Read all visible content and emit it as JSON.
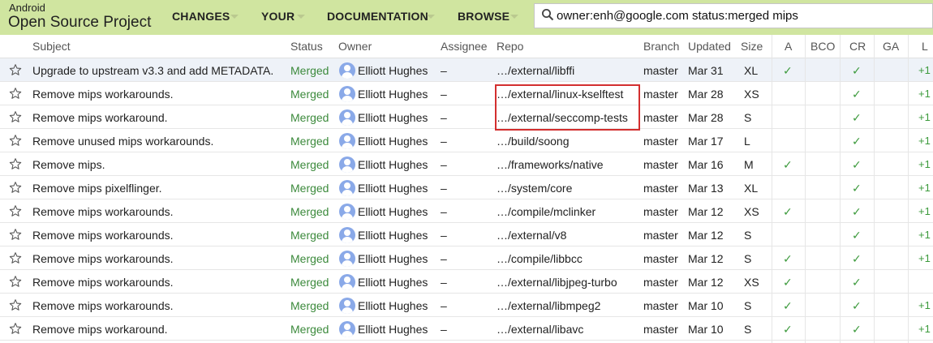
{
  "brand": {
    "top": "Android",
    "main": "Open Source Project"
  },
  "nav": [
    "CHANGES",
    "YOUR",
    "DOCUMENTATION",
    "BROWSE"
  ],
  "search": {
    "value": "owner:enh@google.com status:merged mips"
  },
  "columns": [
    "Subject",
    "Status",
    "Owner",
    "Assignee",
    "Repo",
    "Branch",
    "Updated",
    "Size",
    "A",
    "BCO",
    "CR",
    "GA",
    "L"
  ],
  "rows": [
    {
      "subject": "Upgrade to upstream v3.3 and add METADATA.",
      "status": "Merged",
      "owner": "Elliott Hughes",
      "assignee": "–",
      "repo": "…/external/libffi",
      "branch": "master",
      "updated": "Mar 31",
      "size": "XL",
      "a": "✓",
      "bco": "",
      "cr": "✓",
      "ga": "",
      "l": "+1"
    },
    {
      "subject": "Remove mips workarounds.",
      "status": "Merged",
      "owner": "Elliott Hughes",
      "assignee": "–",
      "repo": "…/external/linux-kselftest",
      "branch": "master",
      "updated": "Mar 28",
      "size": "XS",
      "a": "",
      "bco": "",
      "cr": "✓",
      "ga": "",
      "l": "+1"
    },
    {
      "subject": "Remove mips workaround.",
      "status": "Merged",
      "owner": "Elliott Hughes",
      "assignee": "–",
      "repo": "…/external/seccomp-tests",
      "branch": "master",
      "updated": "Mar 28",
      "size": "S",
      "a": "",
      "bco": "",
      "cr": "✓",
      "ga": "",
      "l": "+1"
    },
    {
      "subject": "Remove unused mips workarounds.",
      "status": "Merged",
      "owner": "Elliott Hughes",
      "assignee": "–",
      "repo": "…/build/soong",
      "branch": "master",
      "updated": "Mar 17",
      "size": "L",
      "a": "",
      "bco": "",
      "cr": "✓",
      "ga": "",
      "l": "+1"
    },
    {
      "subject": "Remove mips.",
      "status": "Merged",
      "owner": "Elliott Hughes",
      "assignee": "–",
      "repo": "…/frameworks/native",
      "branch": "master",
      "updated": "Mar 16",
      "size": "M",
      "a": "✓",
      "bco": "",
      "cr": "✓",
      "ga": "",
      "l": "+1"
    },
    {
      "subject": "Remove mips pixelflinger.",
      "status": "Merged",
      "owner": "Elliott Hughes",
      "assignee": "–",
      "repo": "…/system/core",
      "branch": "master",
      "updated": "Mar 13",
      "size": "XL",
      "a": "",
      "bco": "",
      "cr": "✓",
      "ga": "",
      "l": "+1"
    },
    {
      "subject": "Remove mips workarounds.",
      "status": "Merged",
      "owner": "Elliott Hughes",
      "assignee": "–",
      "repo": "…/compile/mclinker",
      "branch": "master",
      "updated": "Mar 12",
      "size": "XS",
      "a": "✓",
      "bco": "",
      "cr": "✓",
      "ga": "",
      "l": "+1"
    },
    {
      "subject": "Remove mips workarounds.",
      "status": "Merged",
      "owner": "Elliott Hughes",
      "assignee": "–",
      "repo": "…/external/v8",
      "branch": "master",
      "updated": "Mar 12",
      "size": "S",
      "a": "",
      "bco": "",
      "cr": "✓",
      "ga": "",
      "l": "+1"
    },
    {
      "subject": "Remove mips workarounds.",
      "status": "Merged",
      "owner": "Elliott Hughes",
      "assignee": "–",
      "repo": "…/compile/libbcc",
      "branch": "master",
      "updated": "Mar 12",
      "size": "S",
      "a": "✓",
      "bco": "",
      "cr": "✓",
      "ga": "",
      "l": "+1"
    },
    {
      "subject": "Remove mips workarounds.",
      "status": "Merged",
      "owner": "Elliott Hughes",
      "assignee": "–",
      "repo": "…/external/libjpeg-turbo",
      "branch": "master",
      "updated": "Mar 12",
      "size": "XS",
      "a": "✓",
      "bco": "",
      "cr": "✓",
      "ga": "",
      "l": ""
    },
    {
      "subject": "Remove mips workarounds.",
      "status": "Merged",
      "owner": "Elliott Hughes",
      "assignee": "–",
      "repo": "…/external/libmpeg2",
      "branch": "master",
      "updated": "Mar 10",
      "size": "S",
      "a": "✓",
      "bco": "",
      "cr": "✓",
      "ga": "",
      "l": "+1"
    },
    {
      "subject": "Remove mips workaround.",
      "status": "Merged",
      "owner": "Elliott Hughes",
      "assignee": "–",
      "repo": "…/external/libavc",
      "branch": "master",
      "updated": "Mar 10",
      "size": "S",
      "a": "✓",
      "bco": "",
      "cr": "✓",
      "ga": "",
      "l": "+1"
    }
  ],
  "colors": {
    "header_bg": "#d0e5a0",
    "status_merged": "#3c8a3c",
    "highlight": "#d32f2f"
  }
}
